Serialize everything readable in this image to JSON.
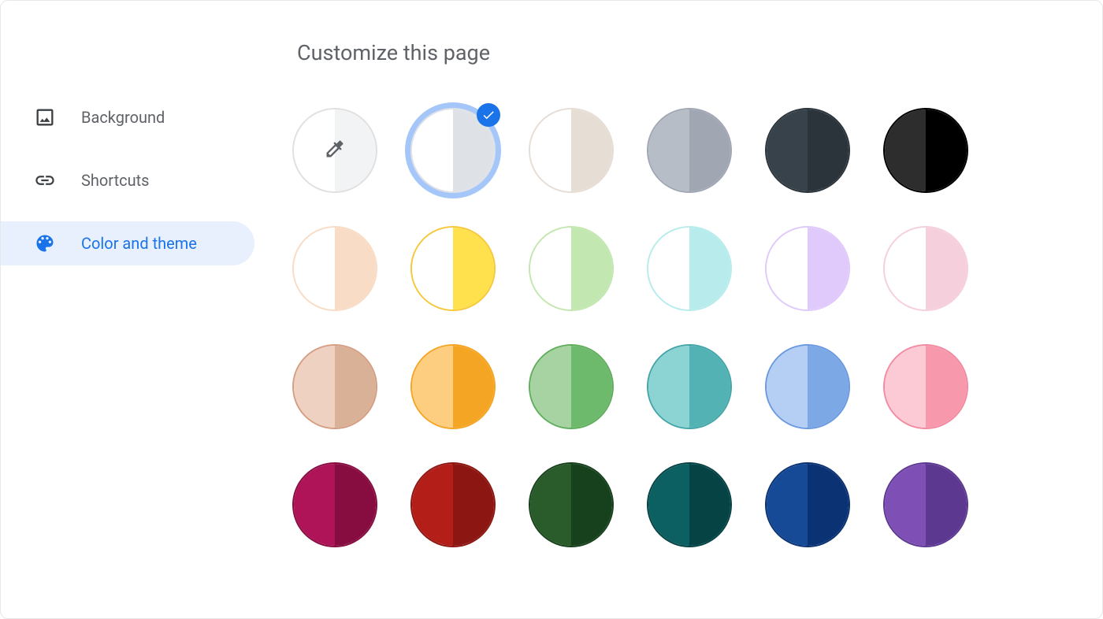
{
  "page_title": "Customize this page",
  "sidebar": {
    "items": [
      {
        "id": "background",
        "label": "Background",
        "icon": "image-icon",
        "active": false
      },
      {
        "id": "shortcuts",
        "label": "Shortcuts",
        "icon": "link-icon",
        "active": false
      },
      {
        "id": "color-theme",
        "label": "Color and theme",
        "icon": "palette-icon",
        "active": true
      }
    ]
  },
  "selected_swatch_index": 1,
  "swatches": [
    {
      "type": "picker",
      "left": "#ffffff",
      "right": "#f1f3f4",
      "border": "#e0e0e0"
    },
    {
      "type": "color",
      "left": "#ffffff",
      "right": "#dee1e6",
      "border": "#dee1e6"
    },
    {
      "type": "color",
      "left": "#ffffff",
      "right": "#e6ddd5",
      "border": "#e6ddd5"
    },
    {
      "type": "color",
      "left": "#b7bdc7",
      "right": "#a0a7b3",
      "border": "#a0a7b3"
    },
    {
      "type": "color",
      "left": "#38424b",
      "right": "#2b343b",
      "border": "#2b343b"
    },
    {
      "type": "color",
      "left": "#2d2d2d",
      "right": "#000000",
      "border": "#000000"
    },
    {
      "type": "color",
      "left": "#ffffff",
      "right": "#f8dcc5",
      "border": "#f8dcc5"
    },
    {
      "type": "color",
      "left": "#ffffff",
      "right": "#ffe14d",
      "border": "#f6c83a"
    },
    {
      "type": "color",
      "left": "#ffffff",
      "right": "#c3e7b0",
      "border": "#c3e7b0"
    },
    {
      "type": "color",
      "left": "#ffffff",
      "right": "#b8ecec",
      "border": "#b8ecec"
    },
    {
      "type": "color",
      "left": "#ffffff",
      "right": "#e0c9fb",
      "border": "#e0c9fb"
    },
    {
      "type": "color",
      "left": "#ffffff",
      "right": "#f6cfdd",
      "border": "#f6cfdd"
    },
    {
      "type": "color",
      "left": "#efd1c2",
      "right": "#d9b197",
      "border": "#d59d82"
    },
    {
      "type": "color",
      "left": "#fdcd80",
      "right": "#f5a524",
      "border": "#f5a524"
    },
    {
      "type": "color",
      "left": "#a7d3a2",
      "right": "#6eba6d",
      "border": "#5fae5b"
    },
    {
      "type": "color",
      "left": "#8cd3d4",
      "right": "#52b2b4",
      "border": "#44a6a9"
    },
    {
      "type": "color",
      "left": "#b5cef3",
      "right": "#7da8e6",
      "border": "#6a99e0"
    },
    {
      "type": "color",
      "left": "#fccad4",
      "right": "#f898ad",
      "border": "#f38aa1"
    },
    {
      "type": "color",
      "left": "#ae1457",
      "right": "#870d41",
      "border": "#870d41"
    },
    {
      "type": "color",
      "left": "#b41e19",
      "right": "#8c1612",
      "border": "#8c1612"
    },
    {
      "type": "color",
      "left": "#2a5b2a",
      "right": "#17411c",
      "border": "#17411c"
    },
    {
      "type": "color",
      "left": "#0d6061",
      "right": "#054345",
      "border": "#054345"
    },
    {
      "type": "color",
      "left": "#164a96",
      "right": "#0b3272",
      "border": "#0b3272"
    },
    {
      "type": "color",
      "left": "#7e4fb5",
      "right": "#5d3891",
      "border": "#5d3891"
    }
  ]
}
